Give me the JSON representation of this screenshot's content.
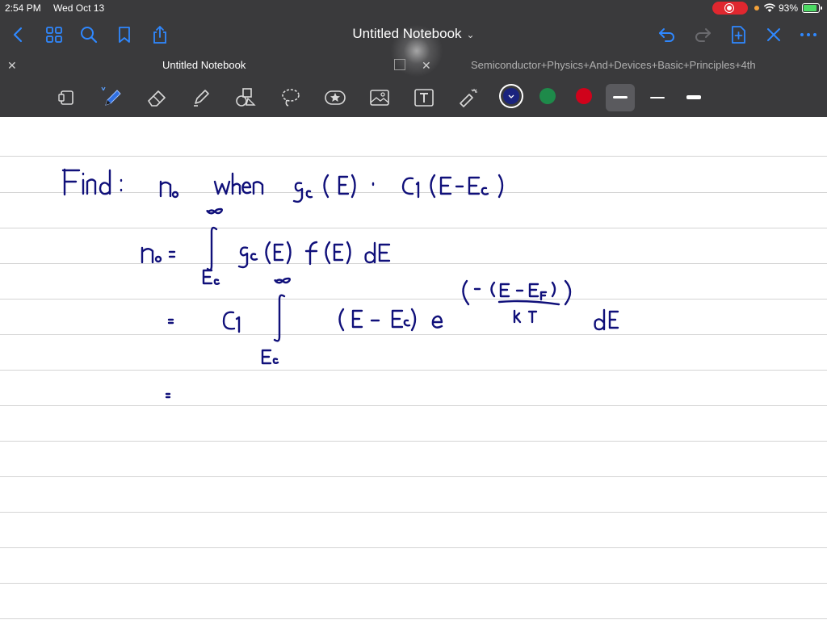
{
  "status_bar": {
    "time": "2:54 PM",
    "date": "Wed Oct 13",
    "battery_percent": "93%",
    "battery_level": 0.93,
    "recording_indicator": "record-icon"
  },
  "nav_bar": {
    "left_icons": [
      "back-chevron-icon",
      "grid-icon",
      "search-icon",
      "bookmark-icon",
      "share-icon"
    ],
    "title": "Untitled Notebook",
    "title_chevron": "⌄",
    "right_icons": [
      "undo-icon",
      "redo-icon",
      "add-page-icon",
      "close-icon",
      "more-icon"
    ]
  },
  "tabs": [
    {
      "label": "Untitled Notebook",
      "active": true
    },
    {
      "label": "Semiconductor+Physics+And+Devices+Basic+Principles+4th",
      "active": false
    }
  ],
  "toolbar": {
    "tools": [
      "page-view-icon",
      "pen-icon",
      "eraser-icon",
      "highlighter-icon",
      "shapes-icon",
      "lasso-icon",
      "sticker-icon",
      "image-icon",
      "text-tool-icon",
      "laser-pointer-icon"
    ],
    "selected_tool": "pen-icon",
    "colors": [
      "#1a237e",
      "#1e8a4a",
      "#d0021b"
    ],
    "selected_color": "#1a237e",
    "stroke_weights": [
      "medium",
      "thin",
      "thick"
    ],
    "selected_weight": "medium"
  },
  "ink_color": "#10107a",
  "note": {
    "line1": "Find : n₀ when g_c(E) = C₁(E − E_c)",
    "line2": "n₀ = ∫_{E_c}^{∞} g_c(E) f(E) dE",
    "line3": "= C₁ ∫_{E_c}^{∞} (E − E_c) e^(−(E − E_F)/kT) dE",
    "line4": "="
  }
}
